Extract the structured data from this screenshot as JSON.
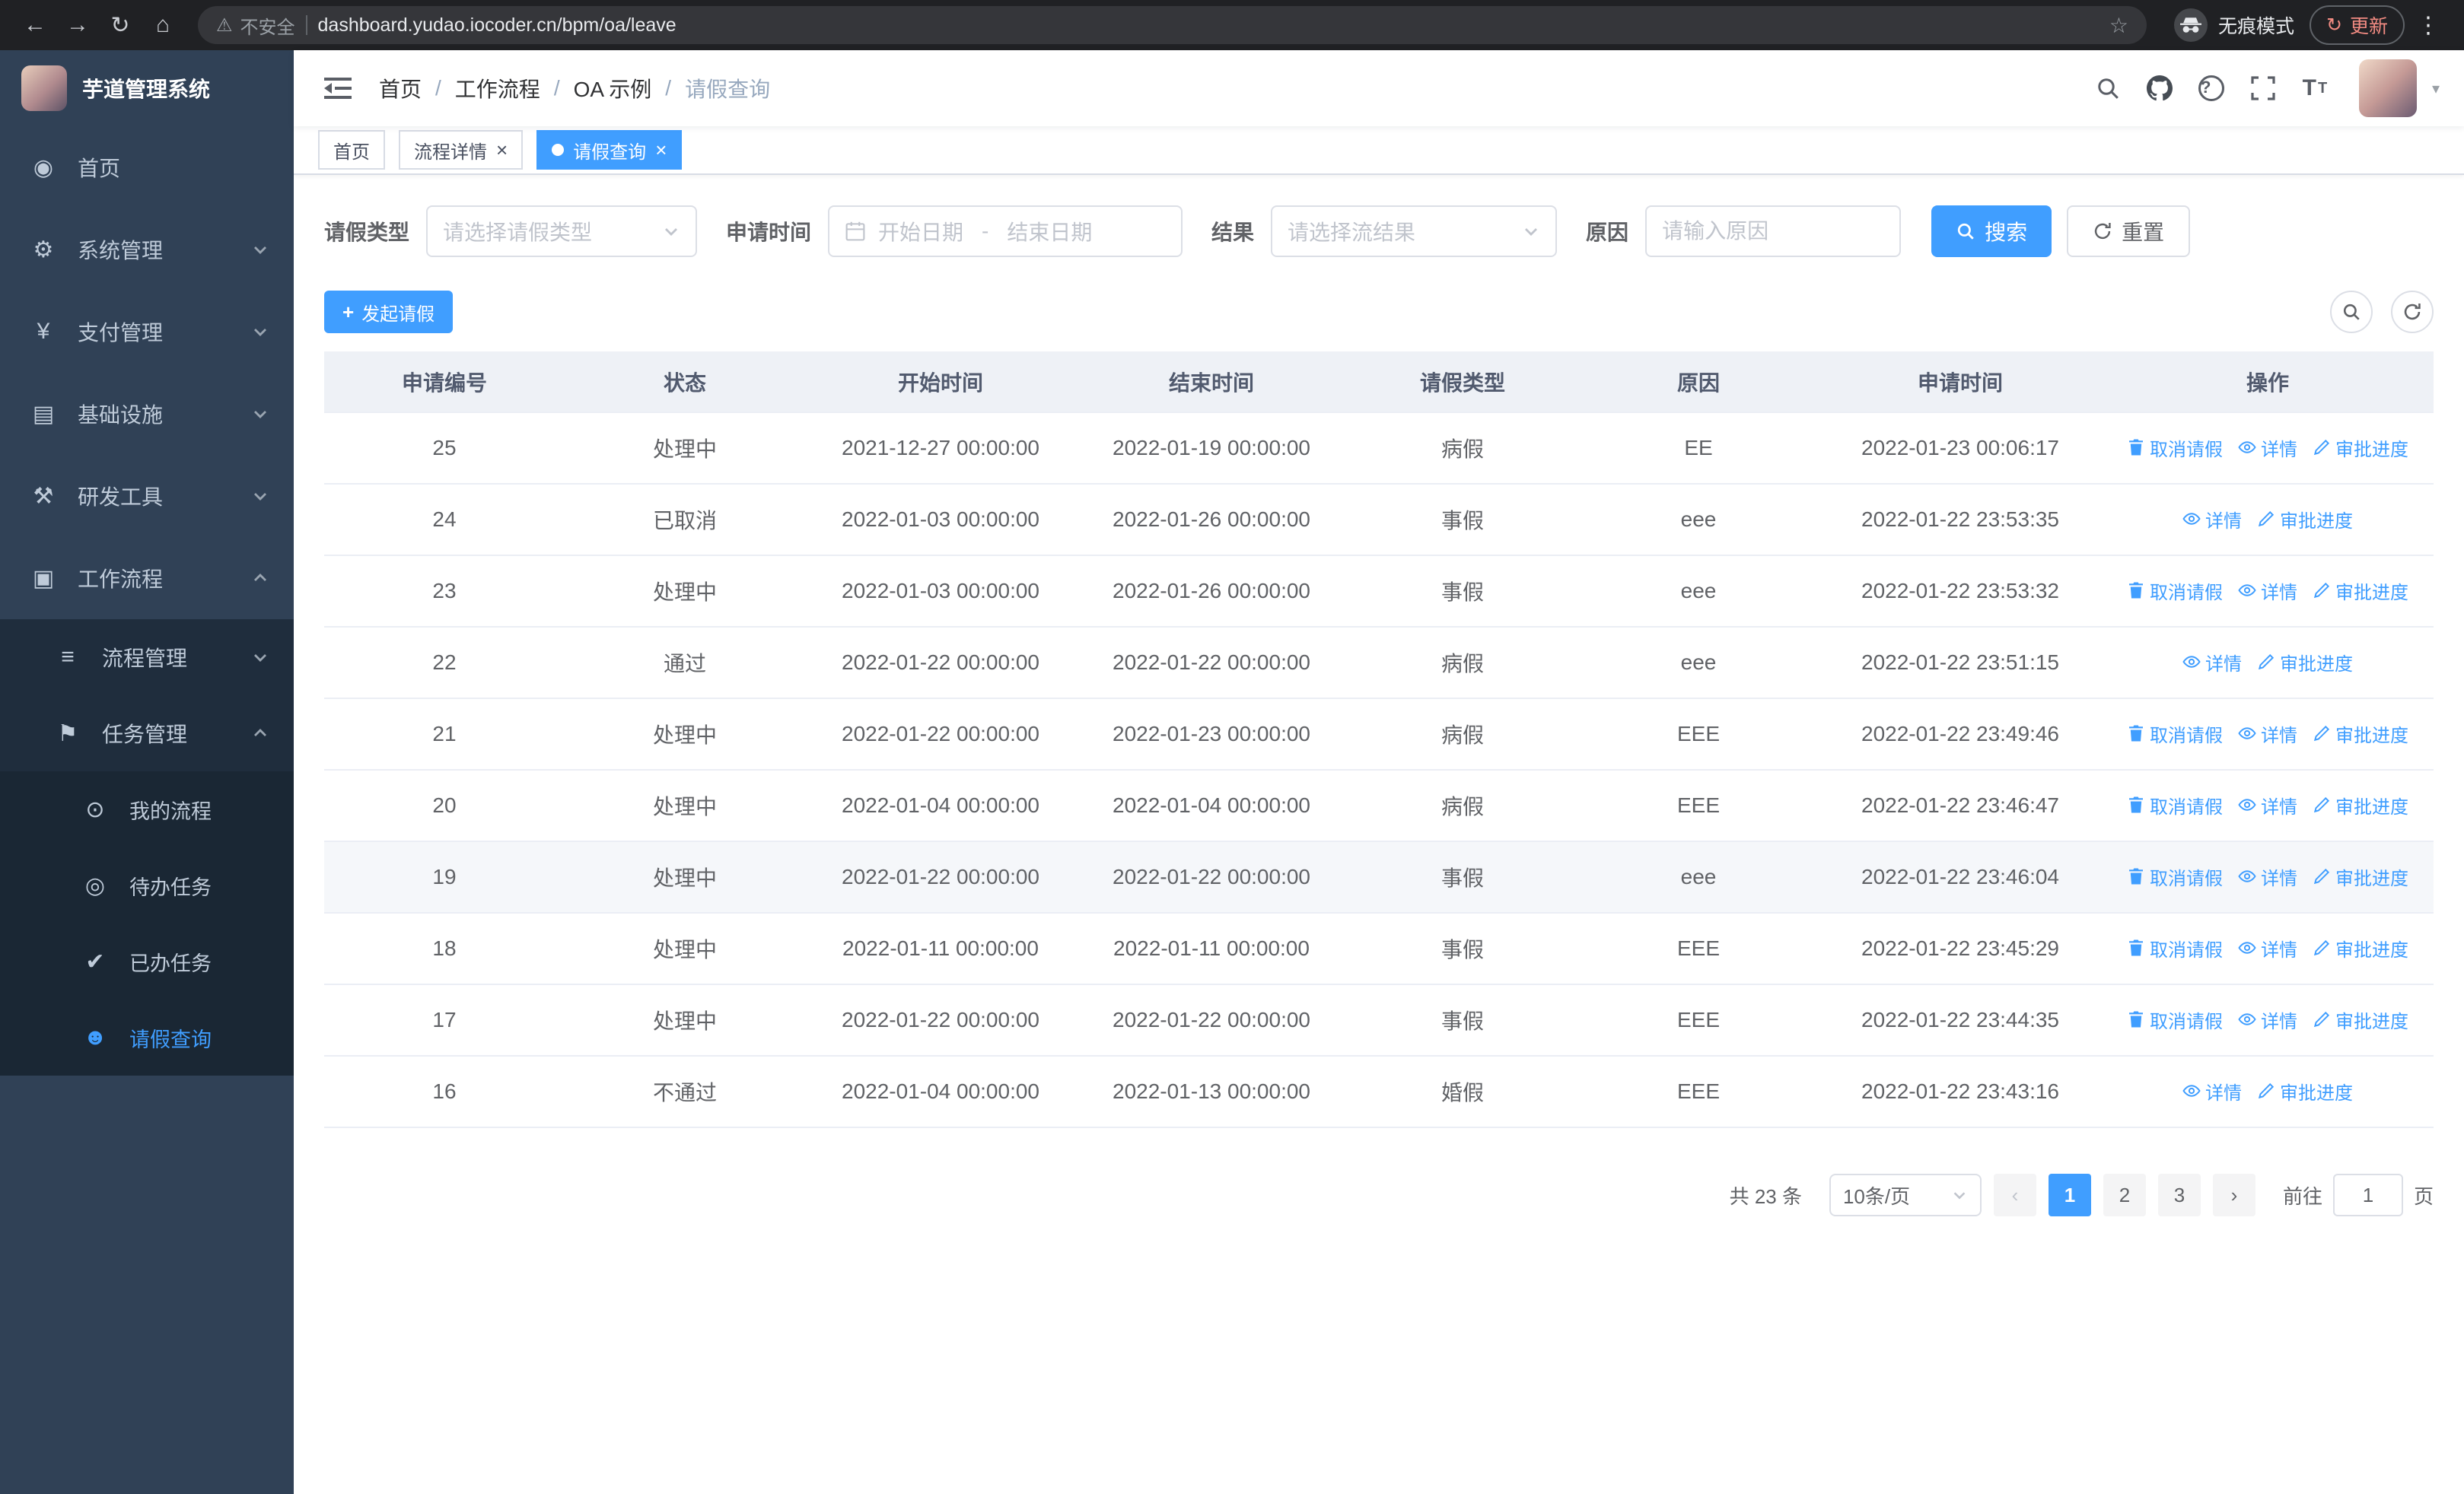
{
  "browser": {
    "security_label": "不安全",
    "url": "dashboard.yudao.iocoder.cn/bpm/oa/leave",
    "incognito_label": "无痕模式",
    "update_label": "更新"
  },
  "sidebar": {
    "app_title": "芋道管理系统",
    "items": [
      {
        "id": "home",
        "label": "首页",
        "icon": "dashboard-icon",
        "expandable": false,
        "expanded": false
      },
      {
        "id": "system",
        "label": "系统管理",
        "icon": "gear-icon",
        "expandable": true,
        "expanded": false
      },
      {
        "id": "payment",
        "label": "支付管理",
        "icon": "yen-icon",
        "expandable": true,
        "expanded": false
      },
      {
        "id": "infrastructure",
        "label": "基础设施",
        "icon": "monitor-icon",
        "expandable": true,
        "expanded": false
      },
      {
        "id": "devtools",
        "label": "研发工具",
        "icon": "tools-icon",
        "expandable": true,
        "expanded": false
      },
      {
        "id": "workflow",
        "label": "工作流程",
        "icon": "briefcase-icon",
        "expandable": true,
        "expanded": true
      }
    ],
    "workflow_children": [
      {
        "id": "process-management",
        "label": "流程管理",
        "icon": "list-icon",
        "expandable": true,
        "expanded": false
      },
      {
        "id": "task-management",
        "label": "任务管理",
        "icon": "flag-icon",
        "expandable": true,
        "expanded": true
      }
    ],
    "task_children": [
      {
        "id": "my-process",
        "label": "我的流程",
        "icon": "chat-icon",
        "active": false
      },
      {
        "id": "todo-task",
        "label": "待办任务",
        "icon": "eye-icon",
        "active": false
      },
      {
        "id": "done-task",
        "label": "已办任务",
        "icon": "check-icon",
        "active": false
      },
      {
        "id": "leave-query",
        "label": "请假查询",
        "icon": "user-icon",
        "active": true
      }
    ]
  },
  "header": {
    "breadcrumb": [
      "首页",
      "工作流程",
      "OA 示例",
      "请假查询"
    ]
  },
  "tabs": [
    {
      "label": "首页",
      "closable": false,
      "active": false
    },
    {
      "label": "流程详情",
      "closable": true,
      "active": false
    },
    {
      "label": "请假查询",
      "closable": true,
      "active": true
    }
  ],
  "filters": {
    "leave_type_label": "请假类型",
    "leave_type_placeholder": "请选择请假类型",
    "apply_time_label": "申请时间",
    "start_date_placeholder": "开始日期",
    "range_separator": "-",
    "end_date_placeholder": "结束日期",
    "result_label": "结果",
    "result_placeholder": "请选择流结果",
    "reason_label": "原因",
    "reason_placeholder": "请输入原因",
    "search_button": "搜索",
    "reset_button": "重置"
  },
  "toolbar": {
    "create_button": "发起请假"
  },
  "table": {
    "columns": [
      "申请编号",
      "状态",
      "开始时间",
      "结束时间",
      "请假类型",
      "原因",
      "申请时间",
      "操作"
    ],
    "actions": {
      "cancel": "取消请假",
      "detail": "详情",
      "progress": "审批进度"
    },
    "rows": [
      {
        "id": "25",
        "status": "处理中",
        "start": "2021-12-27 00:00:00",
        "end": "2022-01-19 00:00:00",
        "type": "病假",
        "reason": "EE",
        "applied": "2022-01-23 00:06:17",
        "cancelable": true,
        "hover": false
      },
      {
        "id": "24",
        "status": "已取消",
        "start": "2022-01-03 00:00:00",
        "end": "2022-01-26 00:00:00",
        "type": "事假",
        "reason": "eee",
        "applied": "2022-01-22 23:53:35",
        "cancelable": false,
        "hover": false
      },
      {
        "id": "23",
        "status": "处理中",
        "start": "2022-01-03 00:00:00",
        "end": "2022-01-26 00:00:00",
        "type": "事假",
        "reason": "eee",
        "applied": "2022-01-22 23:53:32",
        "cancelable": true,
        "hover": false
      },
      {
        "id": "22",
        "status": "通过",
        "start": "2022-01-22 00:00:00",
        "end": "2022-01-22 00:00:00",
        "type": "病假",
        "reason": "eee",
        "applied": "2022-01-22 23:51:15",
        "cancelable": false,
        "hover": false
      },
      {
        "id": "21",
        "status": "处理中",
        "start": "2022-01-22 00:00:00",
        "end": "2022-01-23 00:00:00",
        "type": "病假",
        "reason": "EEE",
        "applied": "2022-01-22 23:49:46",
        "cancelable": true,
        "hover": false
      },
      {
        "id": "20",
        "status": "处理中",
        "start": "2022-01-04 00:00:00",
        "end": "2022-01-04 00:00:00",
        "type": "病假",
        "reason": "EEE",
        "applied": "2022-01-22 23:46:47",
        "cancelable": true,
        "hover": false
      },
      {
        "id": "19",
        "status": "处理中",
        "start": "2022-01-22 00:00:00",
        "end": "2022-01-22 00:00:00",
        "type": "事假",
        "reason": "eee",
        "applied": "2022-01-22 23:46:04",
        "cancelable": true,
        "hover": true
      },
      {
        "id": "18",
        "status": "处理中",
        "start": "2022-01-11 00:00:00",
        "end": "2022-01-11 00:00:00",
        "type": "事假",
        "reason": "EEE",
        "applied": "2022-01-22 23:45:29",
        "cancelable": true,
        "hover": false
      },
      {
        "id": "17",
        "status": "处理中",
        "start": "2022-01-22 00:00:00",
        "end": "2022-01-22 00:00:00",
        "type": "事假",
        "reason": "EEE",
        "applied": "2022-01-22 23:44:35",
        "cancelable": true,
        "hover": false
      },
      {
        "id": "16",
        "status": "不通过",
        "start": "2022-01-04 00:00:00",
        "end": "2022-01-13 00:00:00",
        "type": "婚假",
        "reason": "EEE",
        "applied": "2022-01-22 23:43:16",
        "cancelable": false,
        "hover": false
      }
    ]
  },
  "pagination": {
    "total_text": "共 23 条",
    "page_size": "10条/页",
    "pages": [
      "1",
      "2",
      "3"
    ],
    "active_page": "1",
    "goto_prefix": "前往",
    "goto_value": "1",
    "goto_suffix": "页"
  },
  "colors": {
    "accent": "#409eff",
    "sidebar_bg": "#304156",
    "submenu_bg": "#1f2d3d",
    "table_header_bg": "#eef1f6",
    "update_text": "#f28b82"
  }
}
